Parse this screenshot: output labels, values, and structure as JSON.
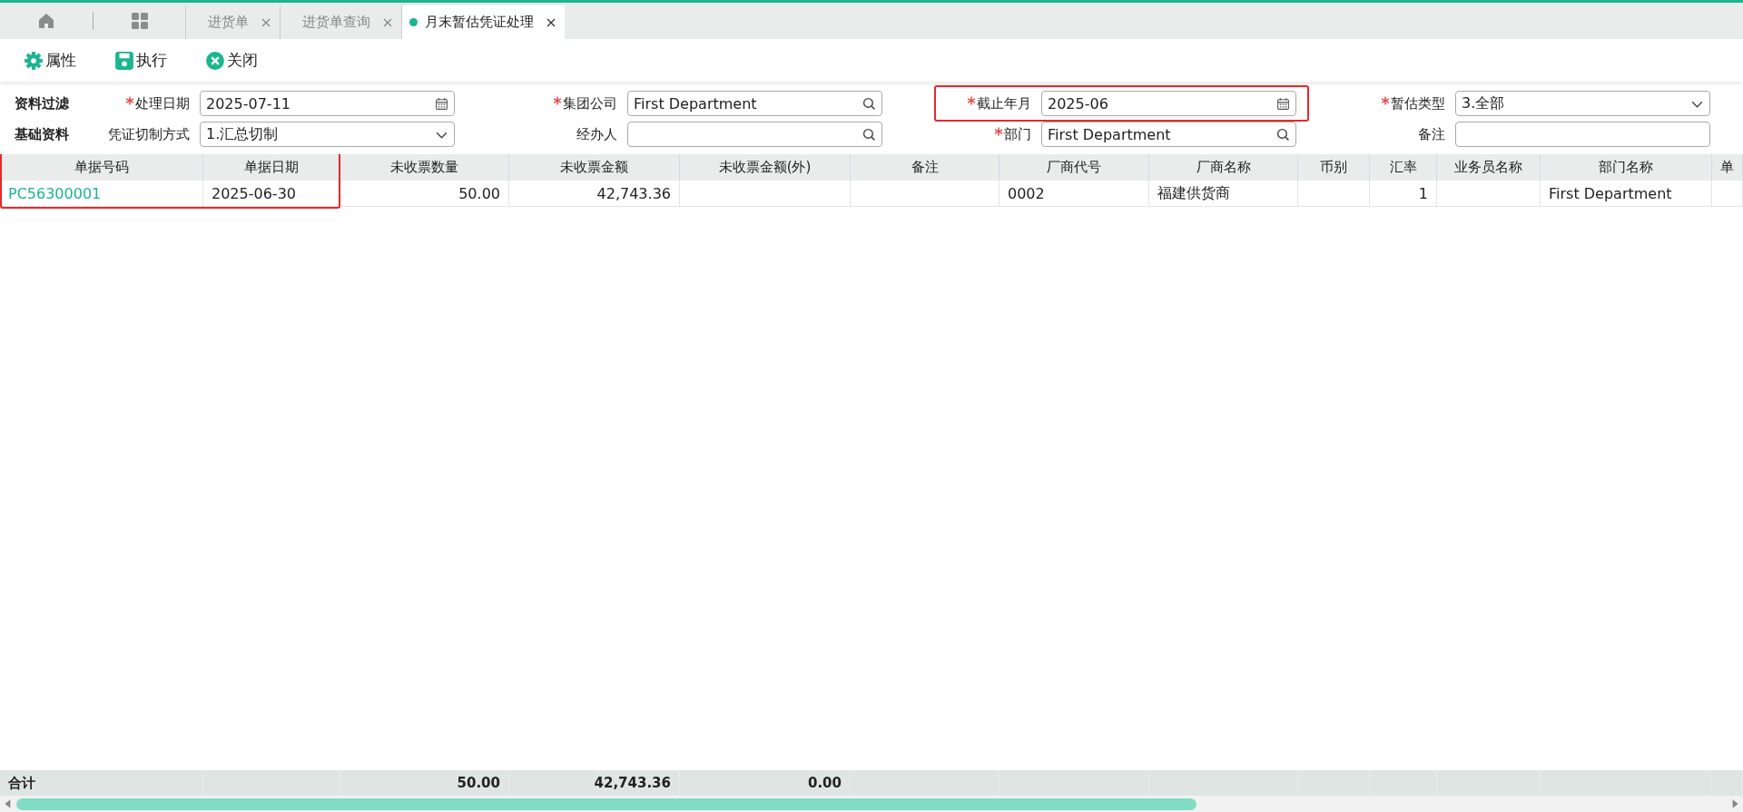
{
  "tabs": [
    {
      "label": "进货单",
      "selected": false,
      "modified": false
    },
    {
      "label": "进货单查询",
      "selected": false,
      "modified": false
    },
    {
      "label": "月末暂估凭证处理",
      "selected": true,
      "modified": true
    }
  ],
  "toolbar": [
    {
      "kind": "gear",
      "label": "属性"
    },
    {
      "kind": "save",
      "label": "执行"
    },
    {
      "kind": "close",
      "label": "关闭"
    }
  ],
  "filter": {
    "section_labels": [
      "资料过滤",
      "基础资料"
    ],
    "rows": [
      [
        {
          "label": "处理日期",
          "required": true,
          "kind": "date",
          "value": "2025-07-11",
          "highlighted": false
        },
        {
          "label": "集团公司",
          "required": true,
          "kind": "search",
          "value": "First Department",
          "highlighted": false
        },
        {
          "label": "截止年月",
          "required": true,
          "kind": "date",
          "value": "2025-06",
          "highlighted": true
        },
        {
          "label": "暂估类型",
          "required": true,
          "kind": "select",
          "value": "3.全部",
          "highlighted": false
        }
      ],
      [
        {
          "label": "凭证切制方式",
          "required": false,
          "kind": "select",
          "value": "1.汇总切制",
          "highlighted": false
        },
        {
          "label": "经办人",
          "required": false,
          "kind": "search",
          "highlighted": false
        },
        {
          "label": "部门",
          "required": true,
          "kind": "search",
          "value": "First Department",
          "highlighted": false
        },
        {
          "label": "备注",
          "required": false,
          "kind": "text",
          "highlighted": false
        }
      ]
    ]
  },
  "table": {
    "columns": [
      {
        "label": "单据号码",
        "highlighted": true
      },
      {
        "label": "单据日期",
        "highlighted": true
      },
      {
        "label": "未收票数量",
        "highlighted": false
      },
      {
        "label": "未收票金额",
        "highlighted": false
      },
      {
        "label": "未收票金额(外)",
        "highlighted": false
      },
      {
        "label": "备注",
        "highlighted": false
      },
      {
        "label": "厂商代号",
        "highlighted": false
      },
      {
        "label": "厂商名称",
        "highlighted": false
      },
      {
        "label": "币别",
        "highlighted": false
      },
      {
        "label": "汇率",
        "highlighted": false
      },
      {
        "label": "业务员名称",
        "highlighted": false
      },
      {
        "label": "部门名称",
        "highlighted": false
      },
      {
        "label": "单",
        "highlighted": false
      }
    ],
    "rows": [
      {
        "cells": [
          "PC56300001",
          "2025-06-30",
          "50.00",
          "42,743.36",
          null,
          null,
          "0002",
          "福建供货商",
          null,
          "1",
          null,
          "First Department",
          null
        ]
      }
    ],
    "totals": {
      "label": "合计",
      "cells": [
        null,
        null,
        "50.00",
        "42,743.36",
        "0.00",
        null,
        null,
        null,
        null,
        null,
        null,
        null,
        null
      ]
    }
  }
}
